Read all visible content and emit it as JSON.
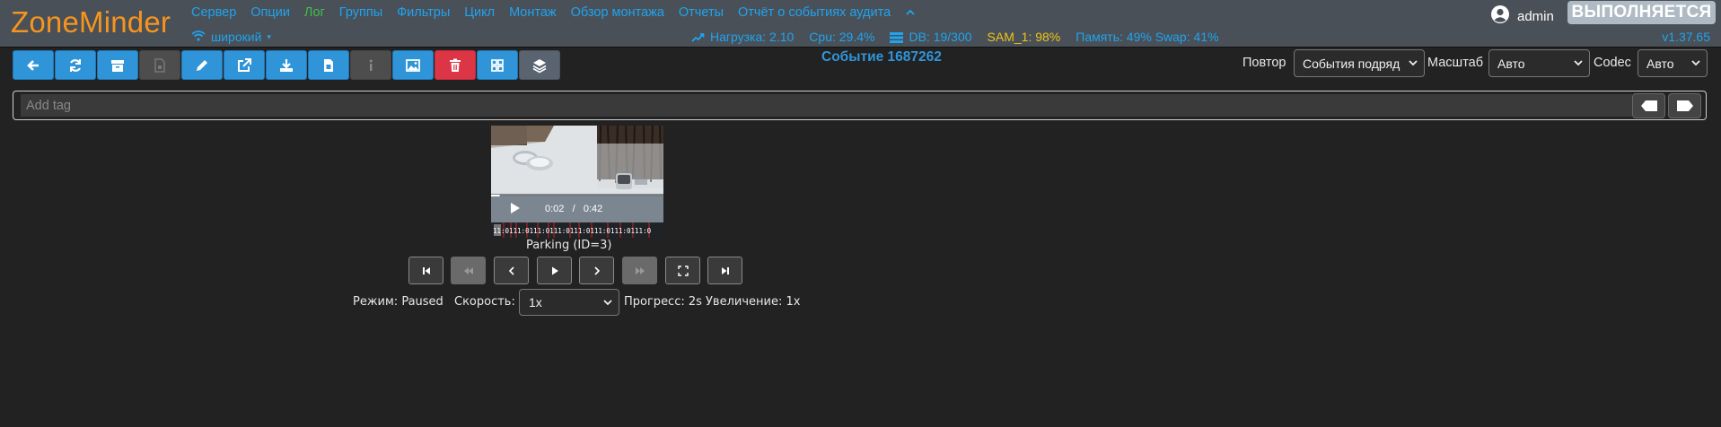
{
  "app": {
    "logo": "ZoneMinder",
    "version": "v1.37.65"
  },
  "nav": {
    "links": [
      "Сервер",
      "Опции",
      "Лог",
      "Группы",
      "Фильтры",
      "Цикл",
      "Монтаж",
      "Обзор монтажа",
      "Отчеты",
      "Отчёт о событиях аудита"
    ],
    "width_label": "широкий",
    "collapse_icon": "chevron-up-icon"
  },
  "status": {
    "load": "Нагрузка: 2.10",
    "cpu": "Cpu: 29.4%",
    "db": "DB: 19/300",
    "storage": "SAM_1: 98%",
    "memory": "Память: 49% Swap: 41%"
  },
  "user": {
    "name": "admin"
  },
  "run_state": "ВЫПОЛНЯЕТСЯ",
  "toolbar": {
    "buttons": [
      {
        "icon": "arrow-left-icon",
        "state": "primary"
      },
      {
        "icon": "refresh-icon",
        "state": "primary"
      },
      {
        "icon": "archive-icon",
        "state": "primary"
      },
      {
        "icon": "unarchive-icon",
        "state": "disabled"
      },
      {
        "icon": "pencil-icon",
        "state": "primary"
      },
      {
        "icon": "external-link-icon",
        "state": "primary"
      },
      {
        "icon": "download-icon",
        "state": "primary"
      },
      {
        "icon": "export-file-icon",
        "state": "primary"
      },
      {
        "icon": "info-icon",
        "state": "disabled"
      },
      {
        "icon": "image-icon",
        "state": "primary"
      },
      {
        "icon": "trash-icon",
        "state": "danger"
      },
      {
        "icon": "grid-icon",
        "state": "primary"
      },
      {
        "icon": "layers-icon",
        "state": "dark"
      }
    ]
  },
  "event": {
    "title": "Событие 1687262"
  },
  "controls": {
    "replay_label": "Повтор",
    "replay_value": "События подряд",
    "scale_label": "Масштаб",
    "scale_value": "Авто",
    "codec_label": "Codec",
    "codec_value": "Авто"
  },
  "tags": {
    "placeholder": "Add tag"
  },
  "video": {
    "current": "0:02",
    "separator": "/",
    "duration": "0:42",
    "timeline_text": "11:0111:0111:0111:0111:0111:0111:0111:0",
    "progress": 0.05
  },
  "monitor_label": "Parking (ID=3)",
  "playback": {
    "buttons": [
      {
        "icon": "skip-start-icon",
        "state": "enabled"
      },
      {
        "icon": "rewind-icon",
        "state": "disabled"
      },
      {
        "icon": "step-back-icon",
        "state": "enabled"
      },
      {
        "icon": "play-icon",
        "state": "enabled"
      },
      {
        "icon": "step-forward-icon",
        "state": "enabled"
      },
      {
        "icon": "fast-forward-icon",
        "state": "disabled"
      },
      {
        "icon": "fullscreen-icon",
        "state": "enabled"
      },
      {
        "icon": "skip-end-icon",
        "state": "enabled"
      }
    ]
  },
  "info": {
    "mode": "Режим: Paused",
    "speed_label": "Скорость:",
    "speed_value": "1x",
    "progress": "Прогресс: 2s",
    "zoom": "Увеличение: 1x"
  },
  "colors": {
    "background": "#222222",
    "navbar": "#495057",
    "accent": "#2f95d8",
    "logo": "#f7941d",
    "log_link": "#3fbf4a",
    "warning": "#f0c419",
    "danger": "#dc3545"
  }
}
